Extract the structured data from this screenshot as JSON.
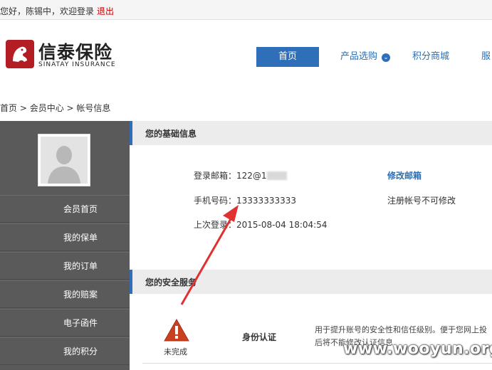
{
  "topbar": {
    "greeting": "您好，",
    "username": "陈锡中",
    "welcome": "，欢迎登录",
    "logout_label": "退出"
  },
  "logo": {
    "cn_name": "信泰保险",
    "en_name": "SINATAY INSURANCE"
  },
  "nav": {
    "items": [
      {
        "label": "首页",
        "active": true
      },
      {
        "label": "产品选购",
        "has_dropdown": true
      },
      {
        "label": "积分商城"
      },
      {
        "label": "服"
      }
    ]
  },
  "breadcrumb": {
    "items": [
      "首页",
      "会员中心",
      "帐号信息"
    ],
    "separator": " > "
  },
  "sidebar": {
    "items": [
      {
        "label": "会员首页"
      },
      {
        "label": "我的保单"
      },
      {
        "label": "我的订单"
      },
      {
        "label": "我的赔案"
      },
      {
        "label": "电子函件"
      },
      {
        "label": "我的积分"
      }
    ]
  },
  "basic_info": {
    "title": "您的基础信息",
    "email_label": "登录邮箱：",
    "email_value": "122@1",
    "edit_email_label": "修改邮箱",
    "phone_label": "手机号码：",
    "phone_value": "13333333333",
    "phone_note": "注册帐号不可修改",
    "last_login_label": "上次登录：",
    "last_login_value": "2015-08-04 18:04:54"
  },
  "security": {
    "title": "您的安全服务",
    "status": "未完成",
    "service_name": "身份认证",
    "description_line1": "用于提升账号的安全性和信任级别。便于您网上投",
    "description_line2": "后将不能修改认证信息"
  },
  "watermark": "www.wooyun.org",
  "colors": {
    "brand_blue": "#2f6fba",
    "brand_red": "#b21e23",
    "annotation_red": "#e03030",
    "sidebar_bg": "#5a5a5a"
  }
}
